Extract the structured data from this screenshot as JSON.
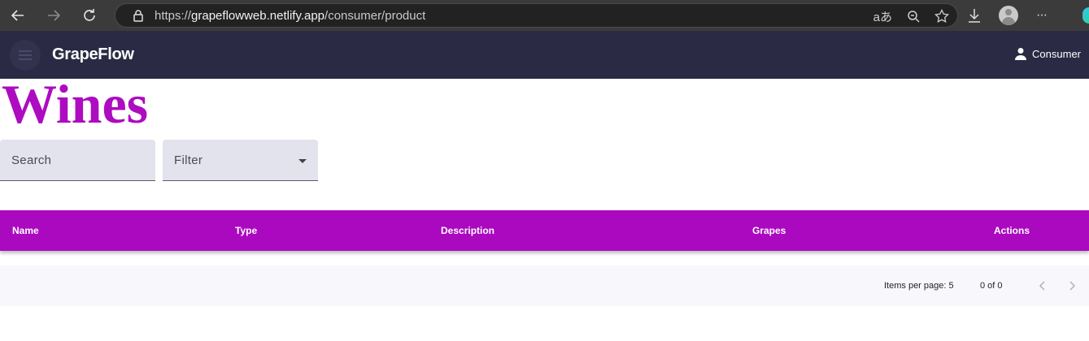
{
  "browser": {
    "url_scheme": "https://",
    "url_host": "grapeflowweb.netlify.app",
    "url_path": "/consumer/product",
    "icons": [
      "back-icon",
      "forward-icon",
      "reload-icon",
      "lock-icon",
      "read-aloud-icon",
      "zoom-icon",
      "favorite-star-icon",
      "download-icon",
      "profile-icon",
      "more-icon"
    ],
    "read_aloud_glyph": "aあ",
    "more_glyph": "···"
  },
  "app": {
    "title": "GrapeFlow",
    "user_label": "Consumer",
    "header_color": "#2a2a44"
  },
  "page": {
    "title": "Wines",
    "title_color": "#ad0cc0"
  },
  "search": {
    "placeholder": "Search",
    "value": ""
  },
  "filter": {
    "label": "Filter"
  },
  "table": {
    "header_color": "#ab09c0",
    "columns": [
      "Name",
      "Type",
      "Description",
      "Grapes",
      "Actions"
    ],
    "rows": []
  },
  "paginator": {
    "items_per_page_label": "Items per page:",
    "items_per_page": "5",
    "range_label": "0 of 0"
  }
}
